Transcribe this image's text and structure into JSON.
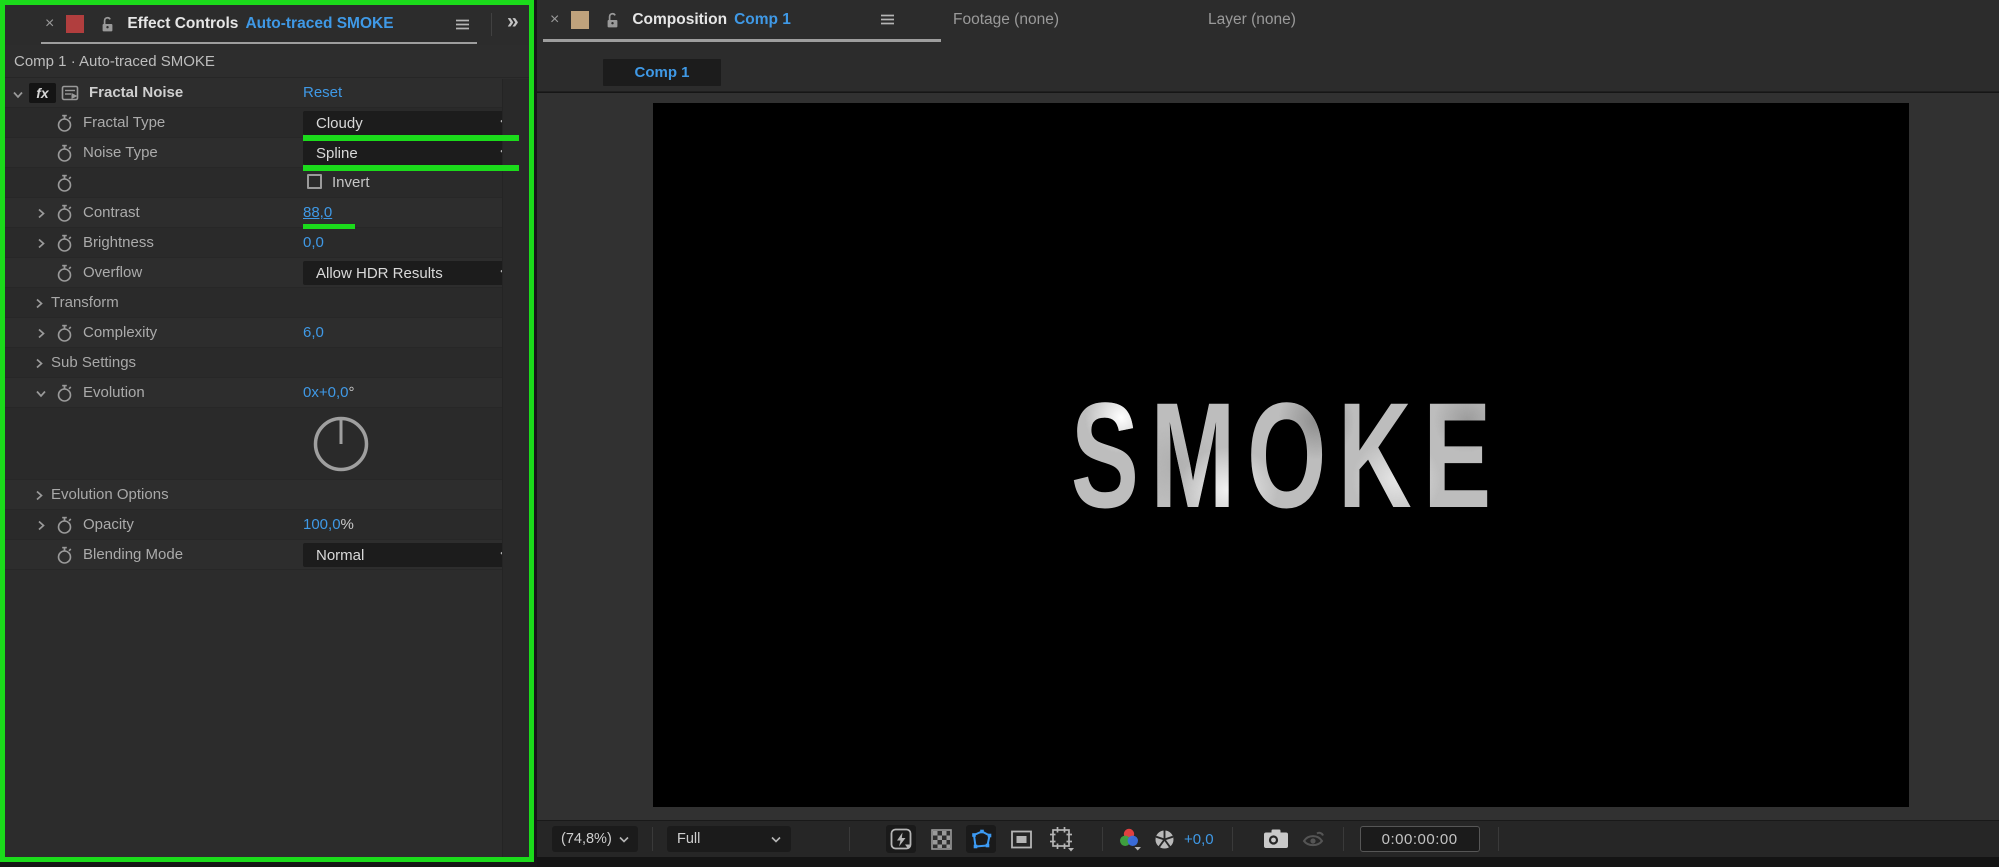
{
  "colors": {
    "annotation_green": "#1BDB1B",
    "link_blue": "#3F99E6",
    "left_panel_swatch": "#B13E3E",
    "right_panel_swatch": "#BFA27C",
    "mask_icon_blue": "#3C9BF4"
  },
  "left_panel": {
    "tab": {
      "close": "×",
      "title": "Effect Controls",
      "subject": "Auto-traced SMOKE"
    },
    "overflow_chevrons": "»",
    "breadcrumb": "Comp 1 · Auto-traced SMOKE",
    "rows": [
      {
        "name": "fractal-noise",
        "type": "effect-header",
        "label": "Fractal Noise",
        "value": "Reset",
        "fx_badge": "fx"
      },
      {
        "name": "fractal-type",
        "type": "dropdown",
        "label": "Fractal Type",
        "value": "Cloudy",
        "annotated": true
      },
      {
        "name": "noise-type",
        "type": "dropdown",
        "label": "Noise Type",
        "value": "Spline",
        "annotated": true
      },
      {
        "name": "invert",
        "type": "checkbox",
        "label": "",
        "value": "Invert",
        "checked": false
      },
      {
        "name": "contrast",
        "type": "value",
        "expander": "collapsed",
        "label": "Contrast",
        "value": "88,0",
        "annotated": true,
        "underlined": true
      },
      {
        "name": "brightness",
        "type": "value",
        "expander": "collapsed",
        "label": "Brightness",
        "value": "0,0"
      },
      {
        "name": "overflow",
        "type": "dropdown",
        "label": "Overflow",
        "value": "Allow HDR Results"
      },
      {
        "name": "transform",
        "type": "group",
        "expander": "collapsed",
        "label": "Transform"
      },
      {
        "name": "complexity",
        "type": "value",
        "expander": "collapsed",
        "label": "Complexity",
        "value": "6,0"
      },
      {
        "name": "sub-settings",
        "type": "group",
        "expander": "collapsed",
        "label": "Sub Settings"
      },
      {
        "name": "evolution",
        "type": "value",
        "expander": "expanded",
        "label": "Evolution",
        "value": "0x+0,0",
        "suffix": "°"
      },
      {
        "name": "evolution-dial",
        "type": "dial"
      },
      {
        "name": "evolution-options",
        "type": "group",
        "expander": "collapsed",
        "label": "Evolution Options"
      },
      {
        "name": "opacity",
        "type": "value",
        "expander": "collapsed",
        "label": "Opacity",
        "value": "100,0",
        "suffix": "%"
      },
      {
        "name": "blending-mode",
        "type": "dropdown",
        "label": "Blending Mode",
        "value": "Normal"
      }
    ]
  },
  "right_panel": {
    "tab": {
      "close": "×",
      "title": "Composition",
      "subject": "Comp 1"
    },
    "other_tabs": [
      {
        "name": "footage",
        "label": "Footage (none)"
      },
      {
        "name": "layer",
        "label": "Layer (none)"
      }
    ],
    "viewer_tab": "Comp 1",
    "canvas_text": "SMOKE",
    "toolbar": {
      "zoom_level": "(74,8%)",
      "resolution": "Full",
      "exposure": "+0,0",
      "timecode": "0:00:00:00"
    }
  }
}
